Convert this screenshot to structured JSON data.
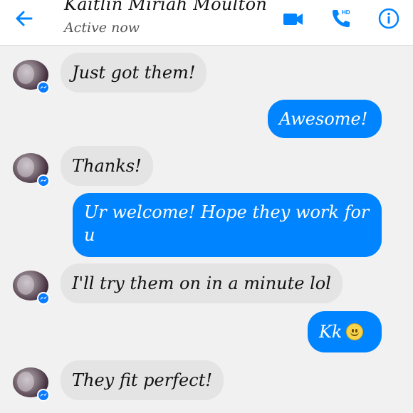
{
  "header": {
    "contact_name": "Kaitlin Miriah Moulton",
    "status": "Active now",
    "call_badge": "HD",
    "icons": [
      "back-arrow-icon",
      "video-camera-icon",
      "phone-icon",
      "info-icon"
    ]
  },
  "colors": {
    "accent": "#0084ff",
    "incoming_bubble": "#e4e4e4",
    "chat_background": "#f1f1f1"
  },
  "messages": [
    {
      "direction": "incoming",
      "text": "Just got them!"
    },
    {
      "direction": "outgoing",
      "text": "Awesome!"
    },
    {
      "direction": "incoming",
      "text": "Thanks!"
    },
    {
      "direction": "outgoing",
      "text": "Ur welcome! Hope they work for u"
    },
    {
      "direction": "incoming",
      "text": "I'll try them on in a minute lol"
    },
    {
      "direction": "outgoing",
      "text": "Kk",
      "emoji": "slightly-smiling-face"
    },
    {
      "direction": "incoming",
      "text": "They fit perfect!"
    }
  ]
}
